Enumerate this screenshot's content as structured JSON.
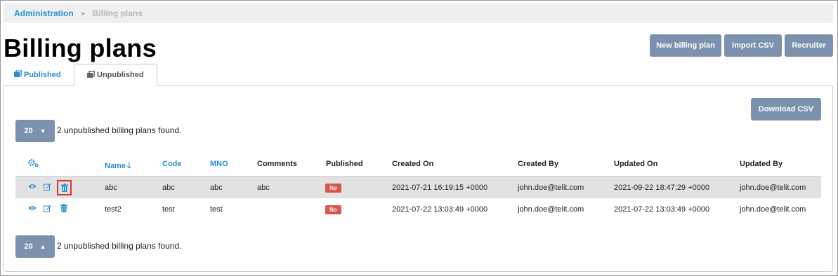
{
  "breadcrumb": {
    "root": "Administration",
    "separator": "►",
    "current": "Billing plans"
  },
  "page_title": "Billing plans",
  "header_buttons": {
    "new": "New billing plan",
    "import": "Import CSV",
    "recruiter": "Recruiter"
  },
  "tabs": {
    "published": "Published",
    "unpublished": "Unpublished",
    "active": "unpublished"
  },
  "panel": {
    "download": "Download CSV",
    "page_size": "20",
    "found_text": "2 unpublished billing plans found."
  },
  "table": {
    "columns": {
      "name": "Name",
      "sort_icon": "🡓",
      "code": "Code",
      "mno": "MNO",
      "comments": "Comments",
      "published": "Published",
      "created_on": "Created On",
      "created_by": "Created By",
      "updated_on": "Updated On",
      "updated_by": "Updated By"
    },
    "rows": [
      {
        "name": "abc",
        "code": "abc",
        "mno": "abc",
        "comments": "abc",
        "published": "No",
        "created_on": "2021-07-21 16:19:15 +0000",
        "created_by": "john.doe@telit.com",
        "updated_on": "2021-09-22 18:47:29 +0000",
        "updated_by": "john.doe@telit.com"
      },
      {
        "name": "test2",
        "code": "test",
        "mno": "test",
        "comments": "",
        "published": "No",
        "created_on": "2021-07-22 13:03:49 +0000",
        "created_by": "john.doe@telit.com",
        "updated_on": "2021-07-22 13:03:49 +0000",
        "updated_by": "john.doe@telit.com"
      }
    ]
  },
  "icons": {
    "view": "view-icon",
    "edit": "edit-icon",
    "delete": "delete-icon",
    "settings": "settings-icon"
  },
  "colors": {
    "accent": "#2a8fd0",
    "button": "#7b91ad",
    "badge_no": "#d9534f",
    "highlight": "#e0332b"
  }
}
